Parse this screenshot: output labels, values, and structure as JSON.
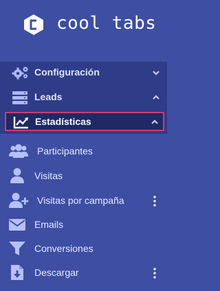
{
  "brand": {
    "name": "cool tabs"
  },
  "nav": {
    "configuracion": {
      "label": "Configuración"
    },
    "leads": {
      "label": "Leads"
    },
    "estadisticas": {
      "label": "Estadísticas"
    }
  },
  "submenu": {
    "participantes": {
      "label": "Participantes"
    },
    "visitas": {
      "label": "Visitas"
    },
    "visitas_campana": {
      "label": "Visitas por campaña"
    },
    "emails": {
      "label": "Emails"
    },
    "conversiones": {
      "label": "Conversiones"
    },
    "descargar": {
      "label": "Descargar"
    }
  },
  "colors": {
    "background": "#3d4ea3",
    "nav_background": "#2f3c87",
    "active_background": "#1f2966",
    "active_border": "#d33a6a"
  }
}
